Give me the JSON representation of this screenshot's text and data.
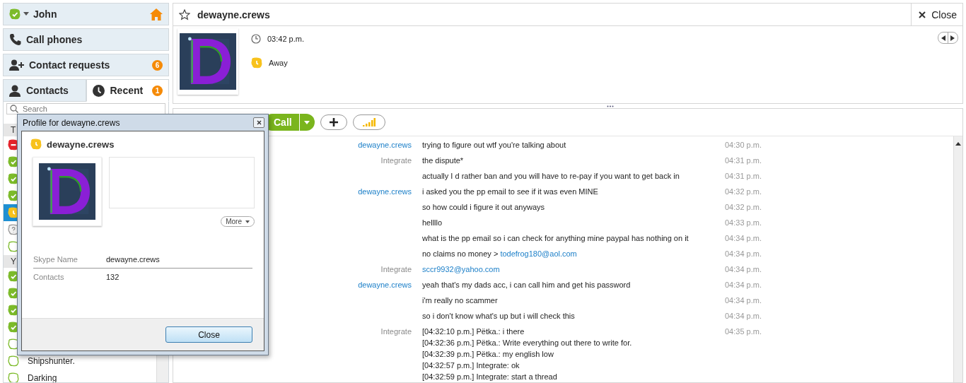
{
  "sidebar": {
    "account": {
      "name": "John",
      "kind": "online"
    },
    "items": [
      {
        "kind": "phone",
        "label": "Call phones"
      },
      {
        "kind": "requests",
        "label": "Contact requests",
        "badge": "6"
      }
    ],
    "tabs": [
      {
        "kind": "contacts",
        "label": "Contacts",
        "selected": false
      },
      {
        "kind": "recent",
        "label": "Recent",
        "selected": true,
        "badge": "1"
      }
    ],
    "search": {
      "placeholder": "Search"
    },
    "groups": [
      {
        "title": "T",
        "contacts": [
          {
            "kind": "dnd",
            "selected": false
          },
          {
            "kind": "online",
            "selected": false
          },
          {
            "kind": "online",
            "selected": false
          },
          {
            "kind": "online",
            "selected": false
          },
          {
            "kind": "away",
            "selected": true
          },
          {
            "kind": "unknown",
            "selected": false
          },
          {
            "kind": "offline",
            "selected": false
          }
        ]
      },
      {
        "title": "Y",
        "contacts": [
          {
            "kind": "online",
            "selected": false
          },
          {
            "kind": "online",
            "selected": false
          },
          {
            "kind": "online",
            "selected": false
          },
          {
            "kind": "online",
            "selected": false
          },
          {
            "kind": "offline",
            "selected": false
          },
          {
            "kind": "offline",
            "selected": false,
            "name": "Shipshunter."
          },
          {
            "kind": "offline",
            "selected": false,
            "name": "Darking"
          }
        ]
      }
    ]
  },
  "conversation": {
    "title": "dewayne.crews",
    "close_label": "Close",
    "local_time": "03:42 p.m.",
    "kind": "away",
    "status_label": "Away",
    "call_label": "Call",
    "messages": [
      {
        "sender": "dewayne.crews",
        "color": "#1b7fc8",
        "time": "04:30 p.m.",
        "lines": [
          [
            {
              "kind": "text",
              "text": "trying to figure out wtf you're talking about"
            }
          ]
        ]
      },
      {
        "sender": "Integrate",
        "color": "#8a8a8a",
        "time": "04:31 p.m.",
        "lines": [
          [
            {
              "kind": "text",
              "text": "the dispute*"
            }
          ]
        ]
      },
      {
        "time": "04:31 p.m.",
        "lines": [
          [
            {
              "kind": "text",
              "text": "actually I d rather ban and you will have to re-pay if you want to get back in"
            }
          ]
        ]
      },
      {
        "sender": "dewayne.crews",
        "color": "#1b7fc8",
        "time": "04:32 p.m.",
        "lines": [
          [
            {
              "kind": "text",
              "text": "i asked you the pp email to see if it was even MINE"
            }
          ]
        ]
      },
      {
        "time": "04:32 p.m.",
        "lines": [
          [
            {
              "kind": "text",
              "text": "so how could i figure it out anyways"
            }
          ]
        ]
      },
      {
        "time": "04:33 p.m.",
        "lines": [
          [
            {
              "kind": "text",
              "text": "hellllo"
            }
          ]
        ]
      },
      {
        "time": "04:34 p.m.",
        "lines": [
          [
            {
              "kind": "text",
              "text": "what is the pp email so i can check for anything mine paypal has nothing on it"
            }
          ]
        ]
      },
      {
        "time": "04:34 p.m.",
        "lines": [
          [
            {
              "kind": "text",
              "text": "no claims no money > "
            },
            {
              "kind": "link",
              "text": "todefrog180@aol.com"
            }
          ]
        ]
      },
      {
        "sender": "Integrate",
        "color": "#8a8a8a",
        "time": "04:34 p.m.",
        "lines": [
          [
            {
              "kind": "link",
              "text": "sccr9932@yahoo.com"
            }
          ]
        ]
      },
      {
        "sender": "dewayne.crews",
        "color": "#1b7fc8",
        "time": "04:34 p.m.",
        "lines": [
          [
            {
              "kind": "text",
              "text": "yeah that's my dads acc, i can call him and get his password"
            }
          ]
        ]
      },
      {
        "time": "04:34 p.m.",
        "lines": [
          [
            {
              "kind": "text",
              "text": "i'm really no scammer"
            }
          ]
        ]
      },
      {
        "time": "04:34 p.m.",
        "lines": [
          [
            {
              "kind": "text",
              "text": "so i don't know what's up but i will check this"
            }
          ]
        ]
      },
      {
        "sender": "Integrate",
        "color": "#8a8a8a",
        "time": "04:35 p.m.",
        "lines": [
          [
            {
              "kind": "text",
              "text": "[04:32:10 p.m.] Pëtka.: i there"
            }
          ],
          [
            {
              "kind": "text",
              "text": "[04:32:36 p.m.] Pëtka.: Write everything out there to write for."
            }
          ],
          [
            {
              "kind": "text",
              "text": "[04:32:39 p.m.] Pëtka.: my english low"
            }
          ],
          [
            {
              "kind": "text",
              "text": "[04:32:57 p.m.] Integrate: ok"
            }
          ],
          [
            {
              "kind": "text",
              "text": "[04:32:59 p.m.] Integrate: start a thread"
            }
          ]
        ]
      }
    ]
  },
  "profile_dialog": {
    "title": "Profile for dewayne.crews",
    "name": "dewayne.crews",
    "kind": "away",
    "more_label": "More",
    "fields": [
      {
        "label": "Skype Name",
        "value": "dewayne.crews"
      },
      {
        "label": "Contacts",
        "value": "132"
      }
    ],
    "close_label": "Close"
  }
}
